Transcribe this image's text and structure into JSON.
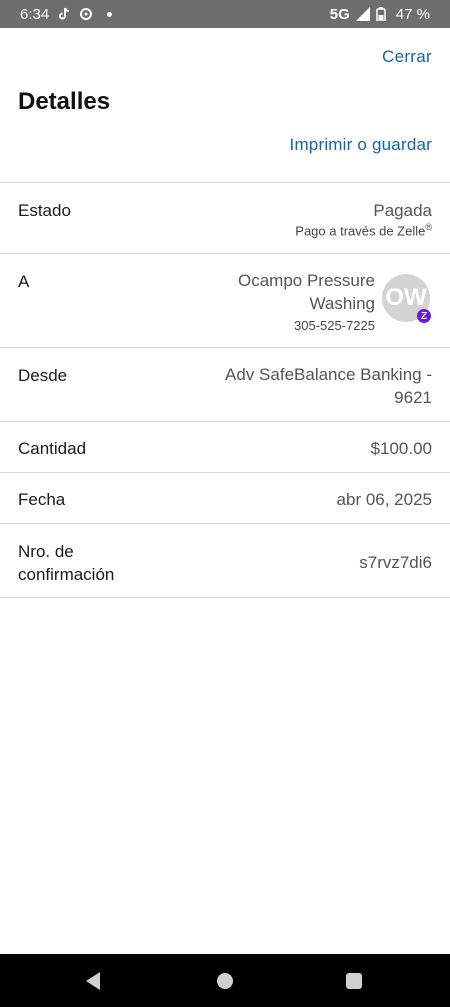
{
  "status_bar": {
    "time": "6:34",
    "network": "5G",
    "battery": "47 %"
  },
  "header": {
    "close_label": "Cerrar",
    "title": "Detalles",
    "print_label": "Imprimir o guardar"
  },
  "details": {
    "estado": {
      "label": "Estado",
      "value": "Pagada",
      "sub": "Pago a través de Zelle",
      "sub_mark": "®"
    },
    "a": {
      "label": "A",
      "name_line1": "Ocampo Pressure",
      "name_line2": "Washing",
      "phone": "305-525-7225",
      "avatar_initials": "OW",
      "badge": "Z"
    },
    "desde": {
      "label": "Desde",
      "value_line1": "Adv SafeBalance Banking -",
      "value_line2": "9621"
    },
    "cantidad": {
      "label": "Cantidad",
      "value": "$100.00"
    },
    "fecha": {
      "label": "Fecha",
      "value": "abr 06, 2025"
    },
    "confirmacion": {
      "label_line1": "Nro. de",
      "label_line2": "confirmación",
      "value": "s7rvz7di6"
    }
  },
  "colors": {
    "link": "#1565a8",
    "zelle_purple": "#6c1cd3",
    "status_bar": "#6e6e6e"
  }
}
